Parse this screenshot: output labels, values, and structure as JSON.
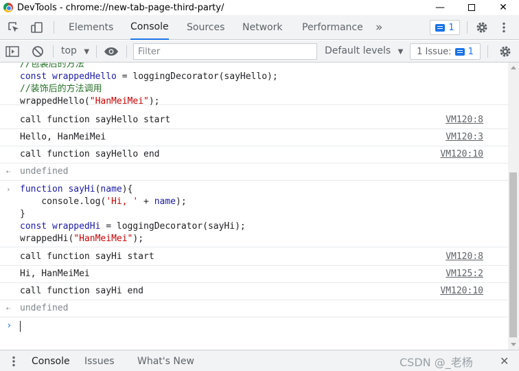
{
  "window": {
    "title": "DevTools - chrome://new-tab-page-third-party/",
    "minimize_glyph": "—",
    "close_glyph": "✕"
  },
  "tabs": [
    {
      "label": "Elements"
    },
    {
      "label": "Console"
    },
    {
      "label": "Sources"
    },
    {
      "label": "Network"
    },
    {
      "label": "Performance"
    }
  ],
  "more_tabs_glyph": "»",
  "issues_badge_count": "1",
  "console_toolbar": {
    "context": "top",
    "filter_placeholder": "Filter",
    "default_levels": "Default levels",
    "issues_label": "1 Issue:",
    "issues_count": "1"
  },
  "console": {
    "code_block_1": [
      "//包装后的方法",
      "const wrappedHello = loggingDecorator(sayHello);",
      "//装饰后的方法调用",
      "wrappedHello(\"HanMeiMei\");"
    ],
    "logs_1": [
      {
        "text": "call function sayHello start",
        "source": "VM120:8"
      },
      {
        "text": "Hello, HanMeiMei",
        "source": "VM120:3"
      },
      {
        "text": "call function sayHello end",
        "source": "VM120:10"
      }
    ],
    "result_1": "undefined",
    "code_block_2": [
      "function sayHi(name){",
      "    console.log('Hi, ' + name);",
      "}",
      "const wrappedHi = loggingDecorator(sayHi);",
      "wrappedHi(\"HanMeiMei\");"
    ],
    "logs_2": [
      {
        "text": "call function sayHi start",
        "source": "VM120:8"
      },
      {
        "text": "Hi, HanMeiMei",
        "source": "VM125:2"
      },
      {
        "text": "call function sayHi end",
        "source": "VM120:10"
      }
    ],
    "result_2": "undefined"
  },
  "drawer": {
    "tabs": [
      {
        "label": "Console"
      },
      {
        "label": "Issues"
      },
      {
        "label": "What's New"
      }
    ],
    "close_glyph": "✕"
  },
  "watermark": "CSDN @_老杨"
}
